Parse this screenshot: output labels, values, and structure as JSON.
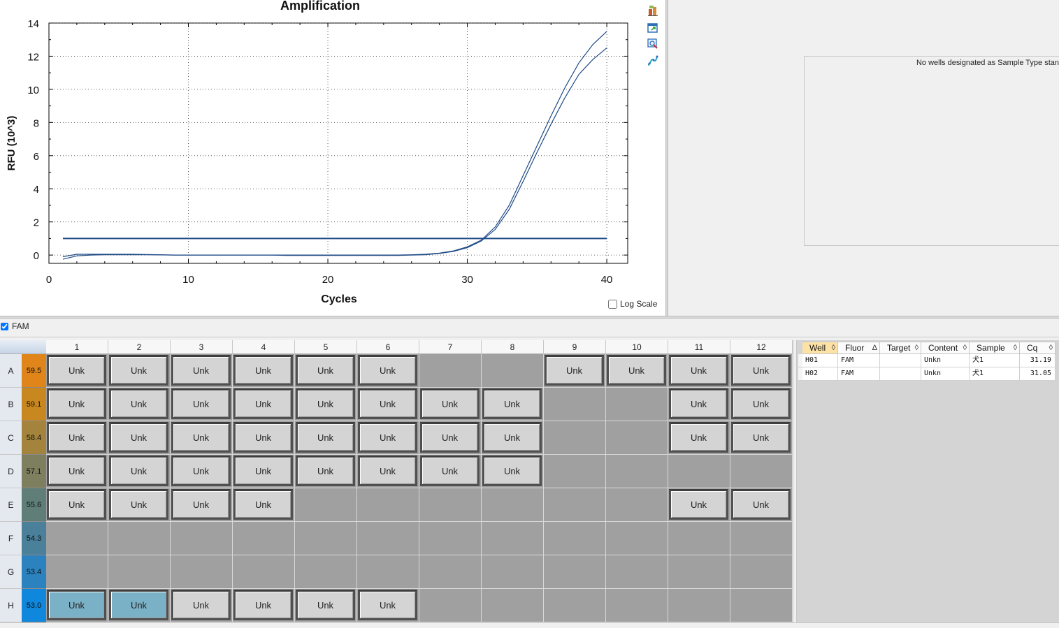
{
  "chart": {
    "log_scale_label": "Log Scale",
    "log_scale_checked": false
  },
  "chart_data": {
    "type": "line",
    "title": "Amplification",
    "xlabel": "Cycles",
    "ylabel": "RFU (10^3)",
    "xlim": [
      0,
      41.5
    ],
    "ylim": [
      -0.5,
      14
    ],
    "xticks": [
      0,
      10,
      20,
      30,
      40
    ],
    "yticks": [
      0,
      2,
      4,
      6,
      8,
      10,
      12,
      14
    ],
    "grid": true,
    "threshold": 1.0,
    "x": [
      1,
      2,
      3,
      4,
      5,
      6,
      7,
      8,
      9,
      10,
      11,
      12,
      13,
      14,
      15,
      16,
      17,
      18,
      19,
      20,
      21,
      22,
      23,
      24,
      25,
      26,
      27,
      28,
      29,
      30,
      31,
      32,
      33,
      34,
      35,
      36,
      37,
      38,
      39,
      40
    ],
    "series": [
      {
        "values": [
          -0.1,
          0.05,
          0.05,
          0.05,
          0.05,
          0.05,
          0.03,
          0.02,
          0.0,
          0.0,
          0.0,
          0.0,
          0.0,
          0.0,
          0.0,
          0.0,
          0.0,
          0.0,
          0.0,
          0.0,
          0.0,
          0.0,
          0.0,
          0.0,
          0.0,
          0.02,
          0.05,
          0.12,
          0.25,
          0.5,
          0.9,
          1.7,
          3.0,
          4.8,
          6.6,
          8.4,
          10.1,
          11.6,
          12.7,
          13.5
        ]
      },
      {
        "values": [
          -0.25,
          -0.05,
          0.0,
          0.02,
          0.02,
          0.02,
          0.02,
          0.01,
          0.0,
          0.0,
          0.0,
          0.0,
          0.0,
          0.0,
          0.0,
          0.0,
          -0.02,
          -0.02,
          -0.02,
          -0.02,
          -0.02,
          -0.02,
          -0.02,
          -0.02,
          -0.02,
          0.0,
          0.02,
          0.1,
          0.22,
          0.45,
          0.85,
          1.55,
          2.75,
          4.45,
          6.2,
          7.9,
          9.5,
          10.9,
          11.8,
          12.5
        ]
      }
    ]
  },
  "standard_curve": {
    "message": "No wells designated as Sample Type stan"
  },
  "fluor_filter": {
    "label": "FAM",
    "checked": true
  },
  "plate": {
    "columns": [
      "1",
      "2",
      "3",
      "4",
      "5",
      "6",
      "7",
      "8",
      "9",
      "10",
      "11",
      "12"
    ],
    "rows": [
      {
        "label": "A",
        "temp": "59.5",
        "color": "#e08519",
        "wells": [
          "Unk",
          "Unk",
          "Unk",
          "Unk",
          "Unk",
          "Unk",
          "",
          "",
          "Unk",
          "Unk",
          "Unk",
          "Unk"
        ]
      },
      {
        "label": "B",
        "temp": "59.1",
        "color": "#c9871f",
        "wells": [
          "Unk",
          "Unk",
          "Unk",
          "Unk",
          "Unk",
          "Unk",
          "Unk",
          "Unk",
          "",
          "",
          "Unk",
          "Unk"
        ]
      },
      {
        "label": "C",
        "temp": "58.4",
        "color": "#a4843c",
        "wells": [
          "Unk",
          "Unk",
          "Unk",
          "Unk",
          "Unk",
          "Unk",
          "Unk",
          "Unk",
          "",
          "",
          "Unk",
          "Unk"
        ]
      },
      {
        "label": "D",
        "temp": "57.1",
        "color": "#7d7f5e",
        "wells": [
          "Unk",
          "Unk",
          "Unk",
          "Unk",
          "Unk",
          "Unk",
          "Unk",
          "Unk",
          "",
          "",
          "",
          ""
        ]
      },
      {
        "label": "E",
        "temp": "55.6",
        "color": "#5e7e77",
        "wells": [
          "Unk",
          "Unk",
          "Unk",
          "Unk",
          "",
          "",
          "",
          "",
          "",
          "",
          "Unk",
          "Unk"
        ]
      },
      {
        "label": "F",
        "temp": "54.3",
        "color": "#4a809a",
        "wells": [
          "",
          "",
          "",
          "",
          "",
          "",
          "",
          "",
          "",
          "",
          "",
          ""
        ]
      },
      {
        "label": "G",
        "temp": "53.4",
        "color": "#2b82be",
        "wells": [
          "",
          "",
          "",
          "",
          "",
          "",
          "",
          "",
          "",
          "",
          "",
          ""
        ]
      },
      {
        "label": "H",
        "temp": "53.0",
        "color": "#0f87dc",
        "wells": [
          "Unk",
          "Unk",
          "Unk",
          "Unk",
          "Unk",
          "Unk",
          "",
          "",
          "",
          "",
          "",
          ""
        ]
      }
    ],
    "selected": [
      "H1",
      "H2"
    ]
  },
  "results": {
    "headers": [
      "Well",
      "Fluor",
      "Target",
      "Content",
      "Sample",
      "Cq"
    ],
    "sort_arrows": [
      "◊",
      "Δ",
      "◊",
      "◊",
      "◊",
      "◊"
    ],
    "rows": [
      [
        "H01",
        "FAM",
        "",
        "Unkn",
        "犬1",
        "31.19"
      ],
      [
        "H02",
        "FAM",
        "",
        "Unkn",
        "犬1",
        "31.05"
      ]
    ]
  },
  "toolbar_icons": [
    "chart-settings-icon",
    "export-icon",
    "zoom-chart-icon",
    "curve-fit-icon"
  ]
}
